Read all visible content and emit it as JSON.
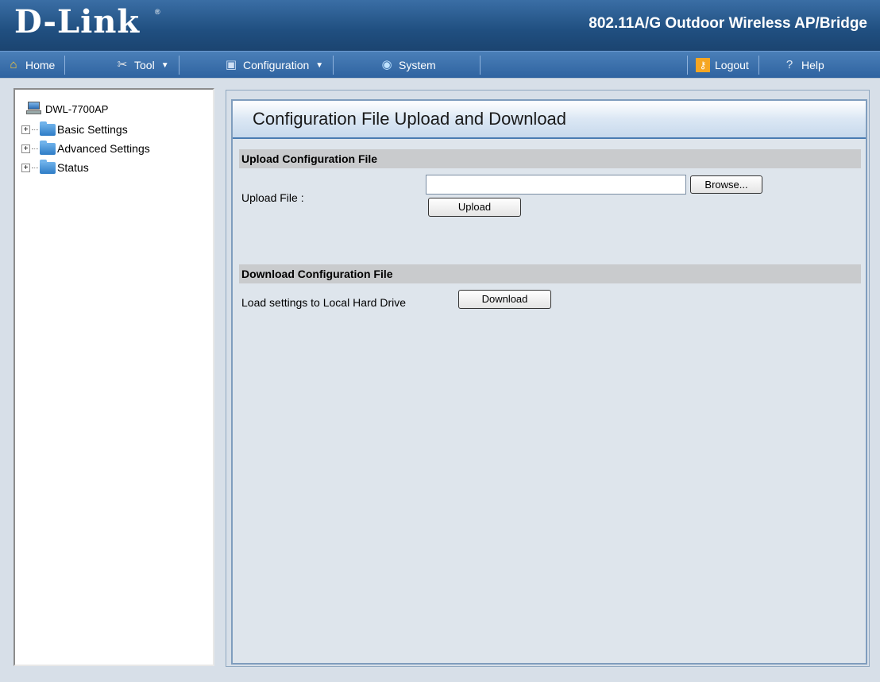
{
  "header": {
    "logo_text": "D-Link",
    "logo_mark": "®",
    "product_title": "802.11A/G Outdoor Wireless AP/Bridge"
  },
  "menubar": {
    "items": [
      {
        "label": "Home",
        "icon": "home-icon",
        "dropdown": false
      },
      {
        "label": "Tool",
        "icon": "tool-icon",
        "dropdown": true
      },
      {
        "label": "Configuration",
        "icon": "save-icon",
        "dropdown": true
      },
      {
        "label": "System",
        "icon": "system-icon",
        "dropdown": false
      }
    ],
    "right_items": [
      {
        "label": "Logout",
        "icon": "key-icon"
      },
      {
        "label": "Help",
        "icon": "help-icon"
      }
    ]
  },
  "tree": {
    "root": "DWL-7700AP",
    "items": [
      {
        "label": "Basic Settings"
      },
      {
        "label": "Advanced Settings"
      },
      {
        "label": "Status"
      }
    ]
  },
  "main": {
    "title": "Configuration File Upload and Download",
    "upload_section": {
      "header": "Upload Configuration File",
      "file_label": "Upload File :",
      "file_value": "",
      "browse_label": "Browse...",
      "upload_label": "Upload"
    },
    "download_section": {
      "header": "Download Configuration File",
      "desc": "Load settings to Local Hard Drive",
      "download_label": "Download"
    }
  }
}
